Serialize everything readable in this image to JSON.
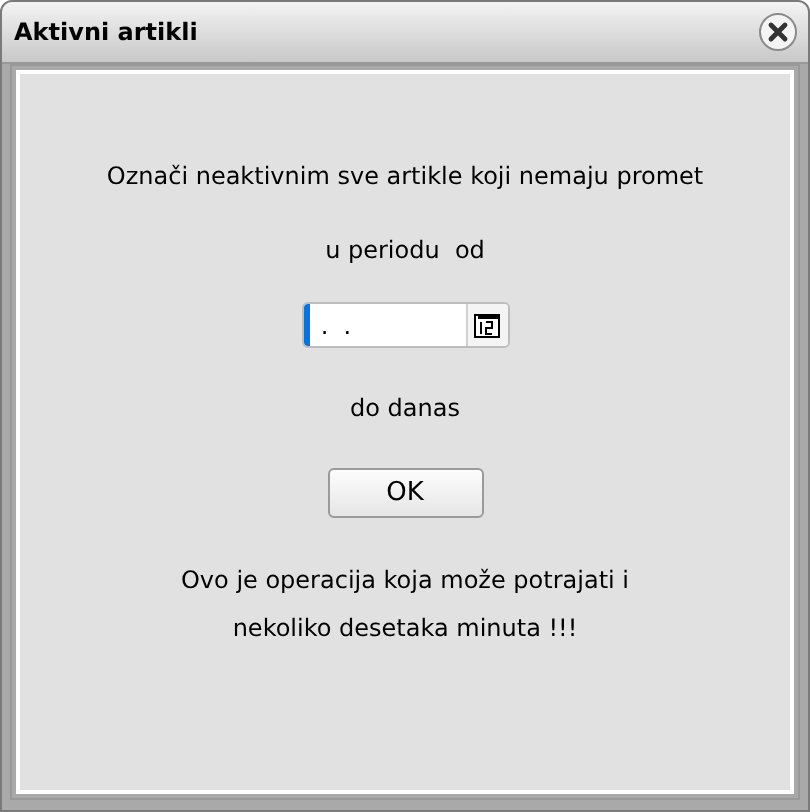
{
  "window": {
    "title": "Aktivni artikli"
  },
  "message": "Označi neaktivnim sve artikle koji nemaju promet",
  "period_label": "u periodu  od",
  "date_field": {
    "value": " .  ."
  },
  "until_label": "do danas",
  "buttons": [
    "OK"
  ],
  "warning": "Ovo je operacija koja može potrajati i nekoliko desetaka minuta !!!"
}
